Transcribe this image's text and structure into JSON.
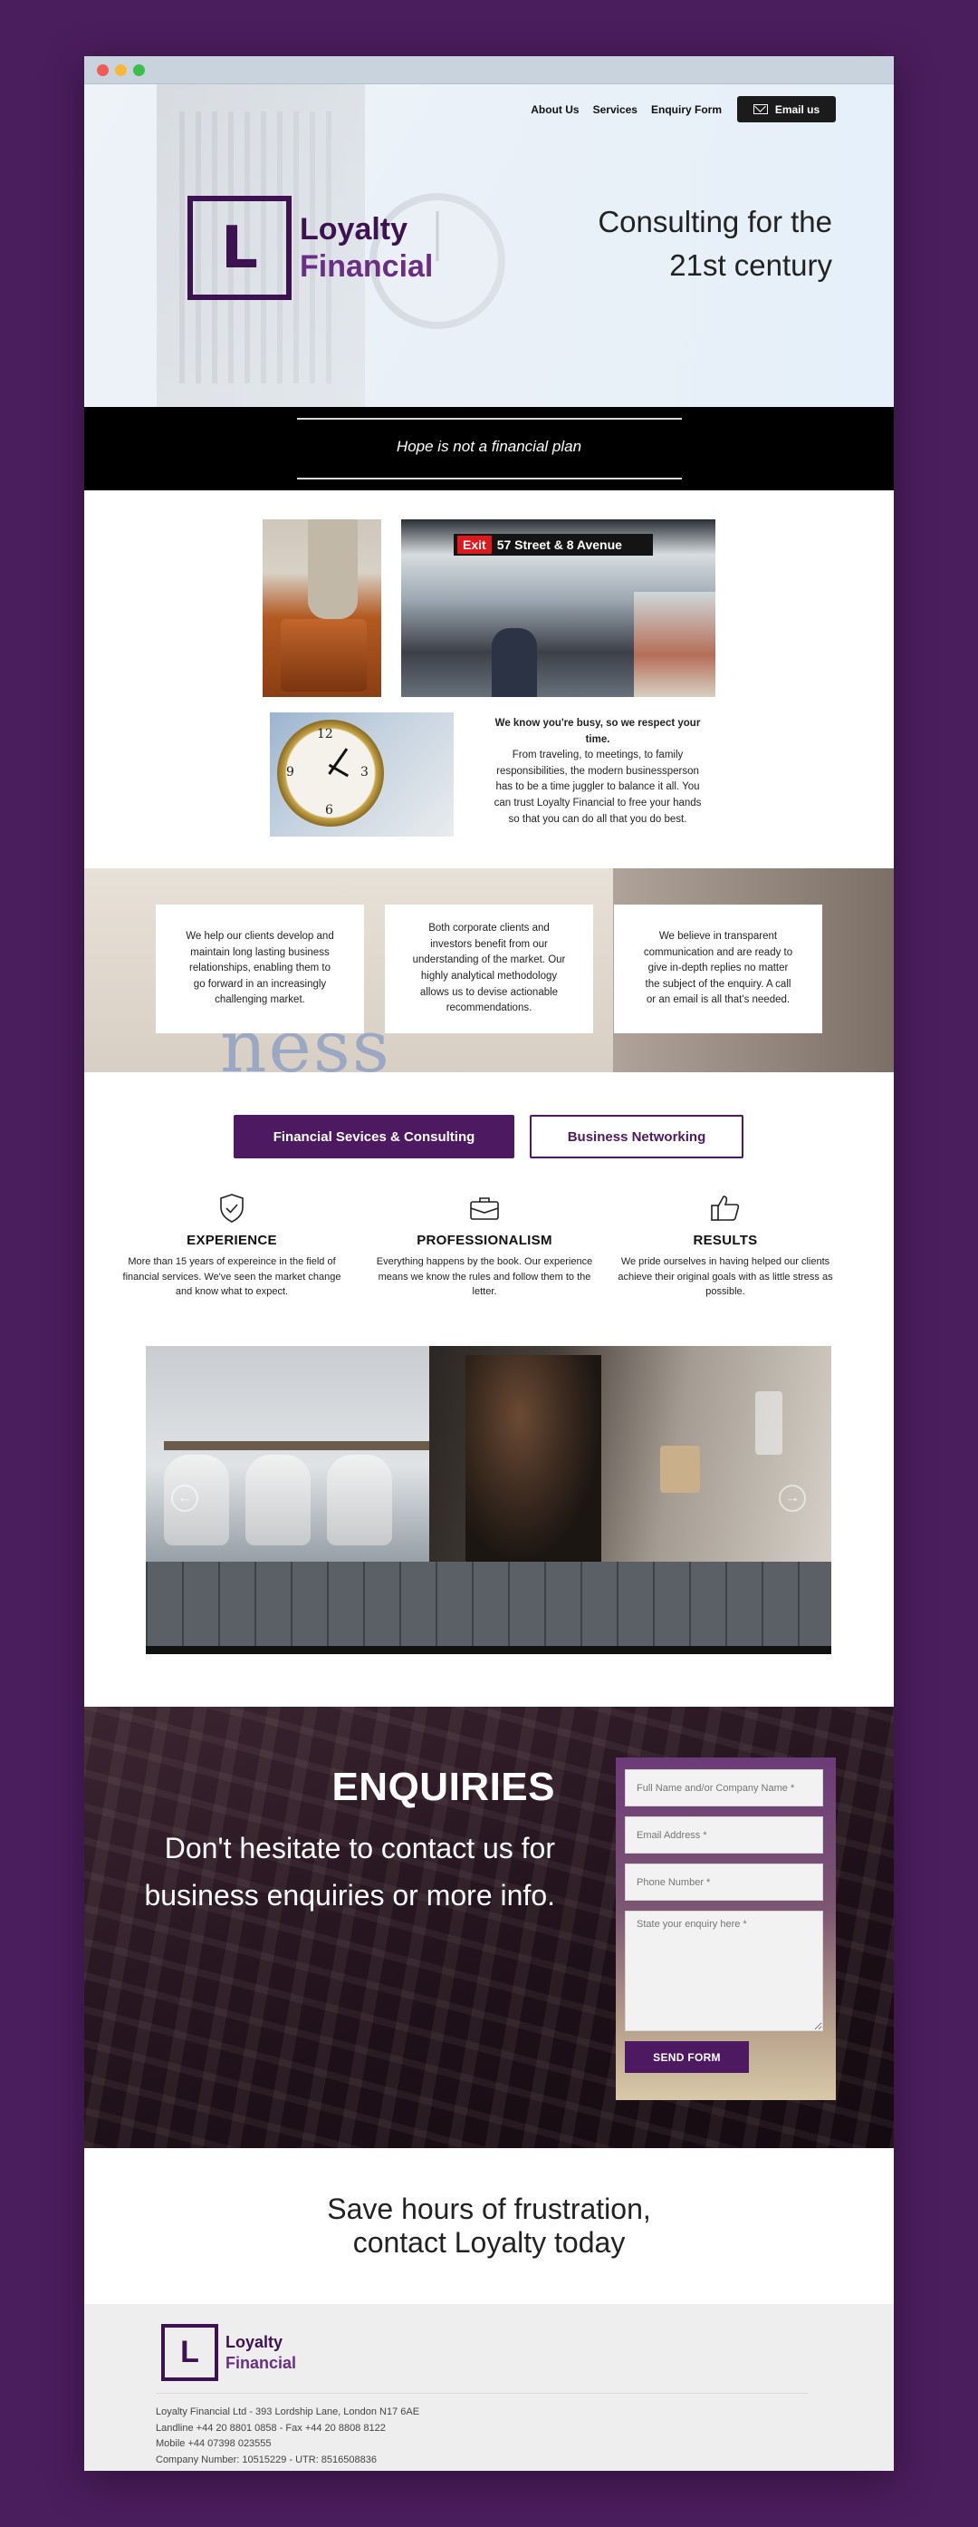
{
  "nav": {
    "about": "About Us",
    "services": "Services",
    "enquiry": "Enquiry Form",
    "email": "Email us"
  },
  "brand": {
    "letter": "L",
    "line1": "Loyalty",
    "line2": "Financial"
  },
  "hero": {
    "tagline_line1": "Consulting for the",
    "tagline_line2": "21st century"
  },
  "motto": "Hope is not a financial plan",
  "photos": {
    "exit_sign": "Exit",
    "street_sign": "57 Street & 8 Avenue"
  },
  "busy": {
    "heading": "We know you're busy, so we respect your time.",
    "body": "From traveling, to meetings, to family responsibilities, the modern businessperson has to be a time juggler to balance it all. You can trust Loyalty Financial to free your hands so that you can do all that you do best."
  },
  "cards": [
    "We help our clients develop and maintain long lasting business relationships, enabling them to go forward in an increasingly challenging market.",
    "Both corporate clients and investors benefit from our understanding of the market. Our highly analytical methodology allows us to devise actionable recommendations.",
    "We believe in transparent communication and are ready to give in-depth replies no matter the subject of the enquiry. A call or an email is all that's needed."
  ],
  "values_word": "ness",
  "tabs": {
    "active": "Financial Sevices & Consulting",
    "inactive": "Business Networking"
  },
  "features": [
    {
      "icon": "shield-check-icon",
      "title": "EXPERIENCE",
      "text": "More than 15 years of expereince in the field of financial services. We've seen the market change and know what to expect."
    },
    {
      "icon": "briefcase-icon",
      "title": "PROFESSIONALISM",
      "text": "Everything happens by the book. Our experience means we know the rules and follow them to the letter."
    },
    {
      "icon": "thumbs-up-icon",
      "title": "RESULTS",
      "text": "We pride ourselves in having helped our clients achieve their original goals with as little stress as possible."
    }
  ],
  "enquiries": {
    "title": "ENQUIRIES",
    "subtitle": "Don't hesitate to contact us for business enquiries or more info.",
    "name_placeholder": "Full Name and/or Company Name *",
    "email_placeholder": "Email Address *",
    "phone_placeholder": "Phone Number *",
    "message_placeholder": "State your enquiry here *",
    "send": "SEND FORM"
  },
  "cta": {
    "line1": "Save hours of frustration,",
    "line2": "contact Loyalty today"
  },
  "footer": {
    "address": "Loyalty Financial Ltd - 393 Lordship Lane, London N17 6AE",
    "landline": "Landline +44 20 8801 0858 - Fax +44 20 8808 8122",
    "mobile": "Mobile +44 07398 023555",
    "company": "Company Number: 10515229 - UTR: 8516508836"
  },
  "colors": {
    "brand_purple": "#4d1a62",
    "page_background": "#4a1d5c"
  }
}
